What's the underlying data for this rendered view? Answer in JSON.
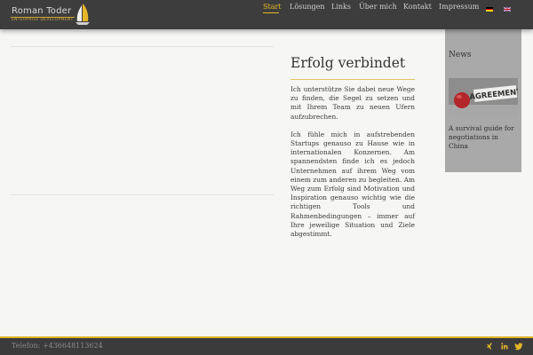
{
  "brand": {
    "name": "Roman Toder",
    "tagline": "ENTERPRISE DEVELOPMENT"
  },
  "nav": {
    "items": [
      {
        "label": "Start",
        "active": true
      },
      {
        "label": "Lösungen",
        "active": false
      },
      {
        "label": "Links",
        "active": false
      },
      {
        "label": "Über mich",
        "active": false
      },
      {
        "label": "Kontakt",
        "active": false
      },
      {
        "label": "Impressum",
        "active": false
      }
    ],
    "languages": [
      "de",
      "en"
    ]
  },
  "article": {
    "title": "Erfolg verbindet",
    "paragraphs": [
      "Ich unterstütze Sie dabei neue Wege zu finden, die Segel zu setzen und mit Ihrem Team zu neuen Ufern aufzubrechen.",
      "Ich fühle mich in aufstrebenden Startups genauso zu Hause wie in internationalen Konzernen. Am spannendsten finde ich es jedoch Unternehmen auf ihrem Weg vom einem zum anderen zu begleiten. Am Weg zum Erfolg sind Motivation und Inspiration genauso wichtig wie die richtigen Tools und Rahmenbedingungen – immer auf Ihre jeweilige Situation und Ziele abgestimmt."
    ]
  },
  "news": {
    "heading": "News",
    "image_text": "AGREEMENT",
    "items": [
      {
        "title": "A survival guide for negotiations in China"
      }
    ]
  },
  "footer": {
    "phone": "Telefon: +436648113624",
    "social": [
      "xing-icon",
      "linkedin-icon",
      "twitter-icon"
    ]
  },
  "colors": {
    "header_bg": "#3d3d3d",
    "accent": "#e5b628",
    "sidebar_bg": "#a9a9a9",
    "page_bg": "#f6f6f4",
    "footer_bg": "#3b3b3b"
  }
}
